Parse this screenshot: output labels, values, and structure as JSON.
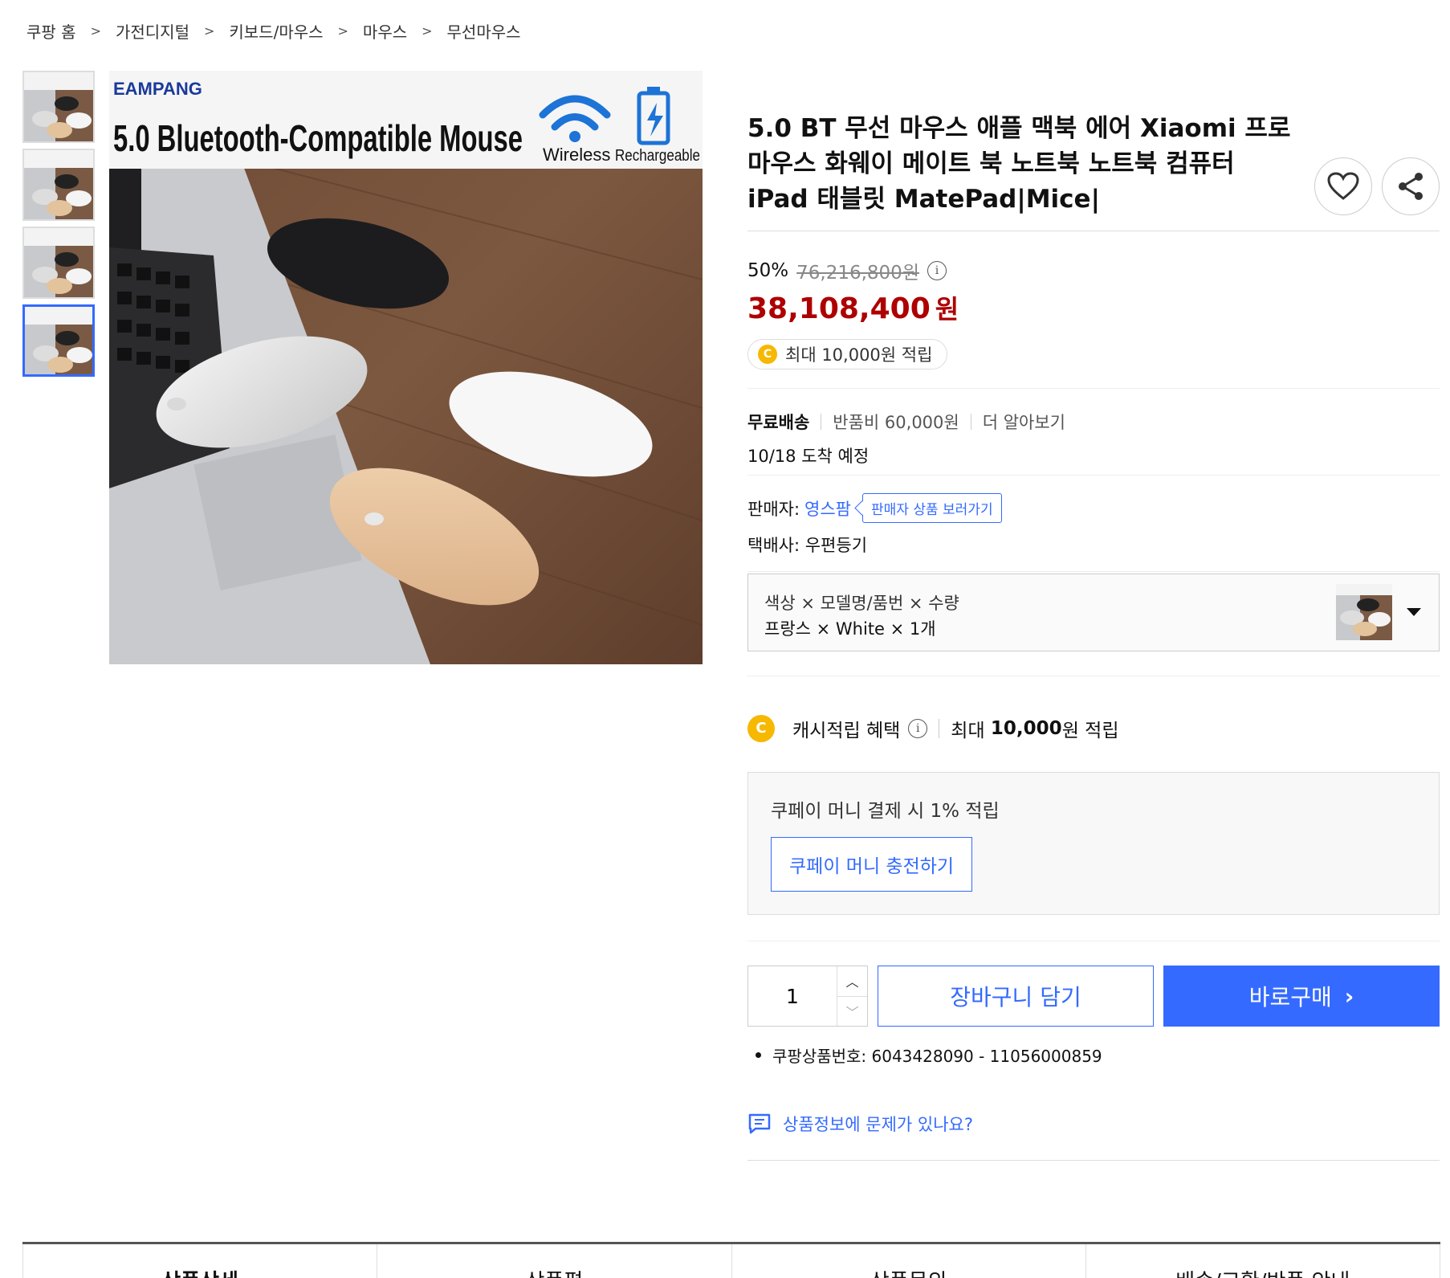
{
  "breadcrumb": [
    "쿠팡 홈",
    "가전디지털",
    "키보드/마우스",
    "마우스",
    "무선마우스"
  ],
  "breadcrumb_separator": ">",
  "product": {
    "title": "5.0 BT 무선 마우스 애플 맥북 에어 Xiaomi 프로 마우스 화웨이 메이트 북 노트북 노트북 컴퓨터 iPad 태블릿 MatePad|Mice|",
    "image_banner": {
      "brand": "EAMPANG",
      "headline": "5.0 Bluetooth-Compatible Mouse",
      "wireless_label": "Wireless",
      "rechargeable_label": "Rechargeable"
    }
  },
  "price": {
    "discount_rate": "50%",
    "original_price": "76,216,800원",
    "sale_price": "38,108,400",
    "currency": "원",
    "cash_reward_chip": "최대 10,000원 적립"
  },
  "shipping": {
    "free_label": "무료배송",
    "return_fee": "반품비 60,000원",
    "more_link": "더 알아보기",
    "arrival": "10/18 도착 예정"
  },
  "seller": {
    "label": "판매자:",
    "name": "영스팜",
    "seller_products_button": "판매자 상품 보러가기",
    "courier_label": "택배사:",
    "courier_name": "우편등기"
  },
  "option": {
    "labels": "색상 × 모델명/품번 × 수량",
    "values": "프랑스 × White × 1개"
  },
  "cash_benefit": {
    "label": "캐시적립 혜택",
    "prefix": "최대",
    "amount": "10,000",
    "suffix": "원 적립"
  },
  "coupay": {
    "text": "쿠페이 머니 결제 시 1% 적립",
    "charge_button": "쿠페이 머니 충전하기"
  },
  "purchase": {
    "quantity": "1",
    "cart_button": "장바구니 담기",
    "buy_button": "바로구매"
  },
  "product_number": "쿠팡상품번호: 6043428090 - 11056000859",
  "report_link": "상품정보에 문제가 있나요?",
  "tabs": [
    "상품상세",
    "상품평",
    "상품문의",
    "배송/교환/반품 안내"
  ],
  "colors": {
    "accent": "#346aff",
    "sale_price": "#ae0000",
    "coin": "#f6b800"
  }
}
